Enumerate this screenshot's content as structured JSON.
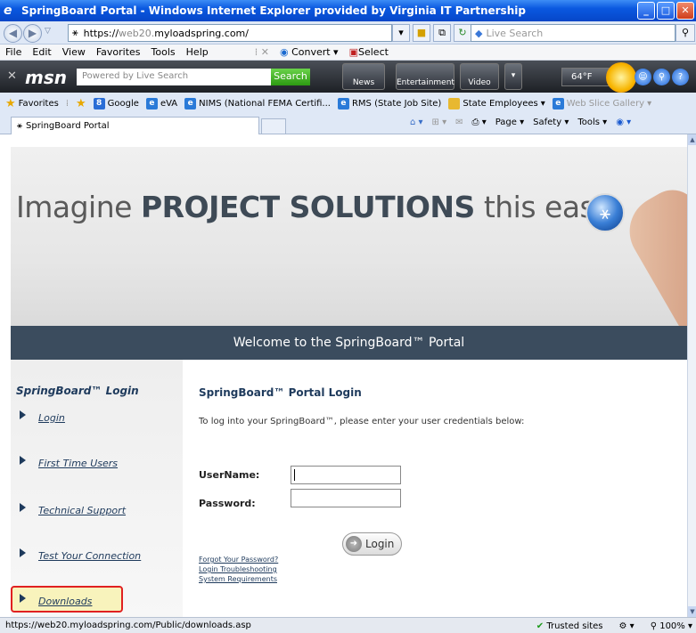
{
  "window": {
    "title": "SpringBoard Portal - Windows Internet Explorer provided by Virginia IT Partnership",
    "buttons": [
      "_",
      "□",
      "✕"
    ]
  },
  "address": {
    "prefix": "https://",
    "host_gray": "web20.",
    "host": "myloadspring.com/",
    "search_placeholder": "Live Search"
  },
  "menu": {
    "items": [
      "File",
      "Edit",
      "View",
      "Favorites",
      "Tools",
      "Help"
    ],
    "convert": "Convert",
    "select": "Select"
  },
  "msn": {
    "logo": "msn",
    "search_placeholder": "Powered by Live Search",
    "search_button": "Search",
    "news": "News",
    "entertainment": "Entertainment",
    "video": "Video",
    "weather": "64°F"
  },
  "favorites": {
    "label": "Favorites",
    "items": [
      "Google",
      "eVA",
      "NIMS (National FEMA Certifi...",
      "RMS (State Job Site)",
      "State Employees",
      "Web Slice Gallery"
    ]
  },
  "tab": {
    "label": "SpringBoard Portal",
    "page": "Page",
    "safety": "Safety",
    "tools": "Tools"
  },
  "hero": {
    "pre": "Imagine ",
    "bold": "PROJECT SOLUTIONS",
    "post": " this easy",
    "welcome": "Welcome to the SpringBoard™ Portal"
  },
  "left": {
    "heading": "SpringBoard™ Login",
    "links": [
      "Login",
      "First Time Users",
      "Technical Support",
      "Test Your Connection",
      "Downloads"
    ]
  },
  "login": {
    "heading": "SpringBoard™ Portal Login",
    "intro": "To log into your SpringBoard™, please enter your user credentials below:",
    "username_label": "UserName:",
    "password_label": "Password:",
    "button": "Login",
    "forgot": "Forgot Your Password?",
    "troubleshooting": "Login Troubleshooting",
    "requirements": "System Requirements"
  },
  "status": {
    "url": "https://web20.myloadspring.com/Public/downloads.asp",
    "zone": "Trusted sites",
    "zoom": "100%"
  }
}
